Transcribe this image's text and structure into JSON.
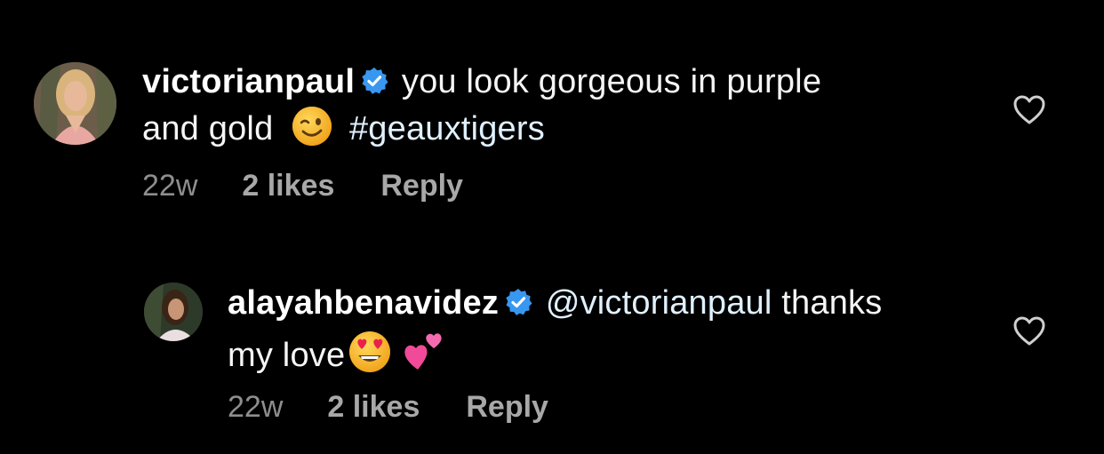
{
  "comments": [
    {
      "username": "victorianpaul",
      "text_before": "you look gorgeous in purple",
      "text_line2": "and gold",
      "emoji": "winking-face",
      "hashtag": "#geauxtigers",
      "time": "22w",
      "likes": "2 likes",
      "reply": "Reply"
    },
    {
      "username": "alayahbenavidez",
      "mention": "@victorianpaul",
      "text_after": "thanks",
      "text_line2": "my love",
      "emojis": [
        "smiling-face-with-heart-eyes",
        "two-hearts"
      ],
      "time": "22w",
      "likes": "2 likes",
      "reply": "Reply"
    }
  ],
  "colors": {
    "background": "#000000",
    "verified": "#3897f0",
    "meta": "#8e8e8e",
    "link": "#e0f1ff"
  }
}
